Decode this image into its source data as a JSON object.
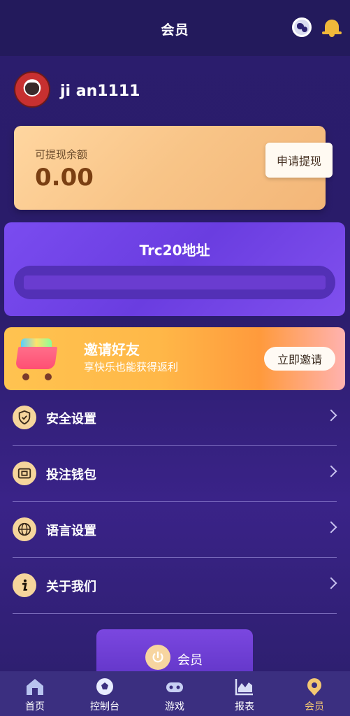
{
  "header": {
    "title": "会员"
  },
  "profile": {
    "username": "ji an1111"
  },
  "balance": {
    "label": "可提现余额",
    "value": "0.00",
    "withdraw_label": "申请提现"
  },
  "trc20": {
    "title": "Trc20地址",
    "value": ""
  },
  "invite": {
    "title": "邀请好友",
    "subtitle": "享快乐也能获得返利",
    "button_label": "立即邀请"
  },
  "menu": {
    "items": [
      {
        "label": "安全设置",
        "icon": "shield-icon"
      },
      {
        "label": "投注钱包",
        "icon": "wallet-icon"
      },
      {
        "label": "语言设置",
        "icon": "globe-icon"
      },
      {
        "label": "关于我们",
        "icon": "info-icon"
      }
    ]
  },
  "member_pill": {
    "label": "会员",
    "icon": "power-icon"
  },
  "tabbar": {
    "tabs": [
      {
        "label": "首页",
        "icon": "home-icon"
      },
      {
        "label": "控制台",
        "icon": "soccer-ball-icon"
      },
      {
        "label": "游戏",
        "icon": "game-icon"
      },
      {
        "label": "报表",
        "icon": "chart-icon"
      },
      {
        "label": "会员",
        "icon": "member-icon",
        "active": true
      }
    ]
  },
  "colors": {
    "background": "#2b1d6e",
    "accent_gold": "#f4c872",
    "balance_card": "#f8c487",
    "trc_card": "#7a4cf0",
    "invite_banner": "#ffb848"
  }
}
